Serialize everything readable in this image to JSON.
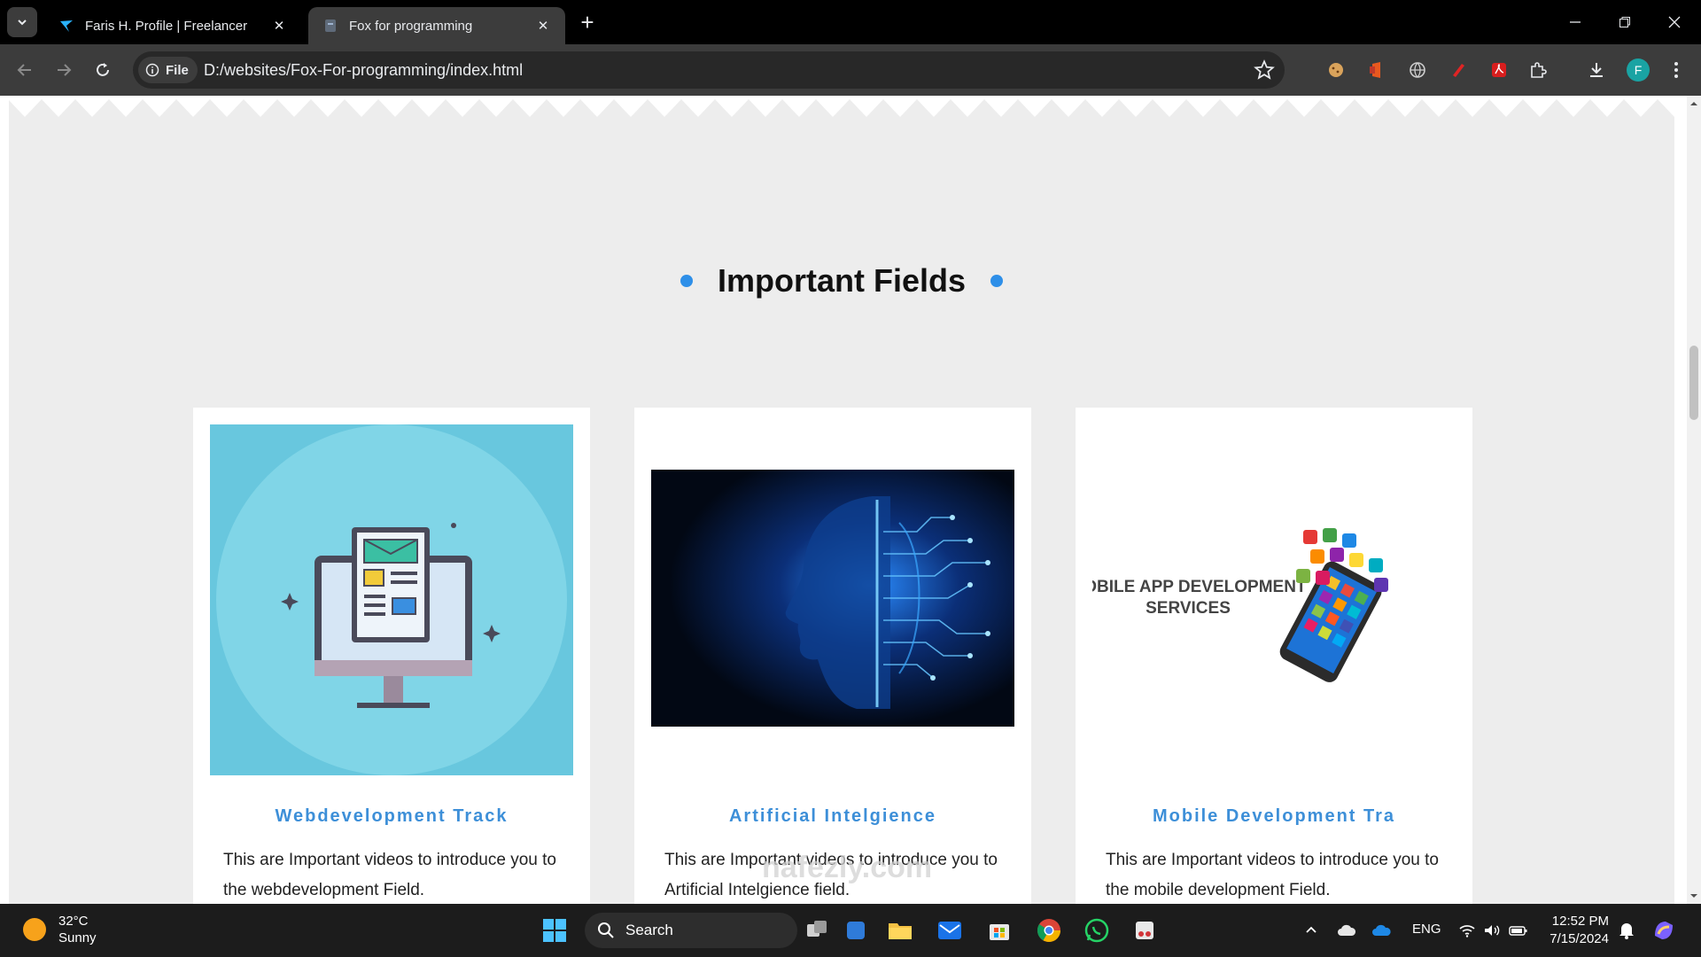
{
  "browser": {
    "tabs": [
      {
        "title": "Faris H. Profile | Freelancer",
        "active": false
      },
      {
        "title": "Fox for programming",
        "active": true
      }
    ],
    "url_chip": "File",
    "url": "D:/websites/Fox-For-programming/index.html",
    "profile_initial": "F"
  },
  "page": {
    "section_title": "Important Fields",
    "cards": [
      {
        "title": "Webdevelopment Track",
        "description": "This are Important videos to introduce you to the webdevelopment Field."
      },
      {
        "title": "Artificial Intelgience",
        "description": "This are Important videos to introduce you to Artificial Intelgience field."
      },
      {
        "title": "Mobile Development Tra",
        "description": "This are Important videos to introduce you to the mobile development Field."
      }
    ],
    "mobile_image_text": [
      "MOBILE APP DEVELOPMENT",
      "SERVICES"
    ]
  },
  "taskbar": {
    "weather_temp": "32°C",
    "weather_desc": "Sunny",
    "search_label": "Search",
    "language": "ENG",
    "time": "12:52 PM",
    "date": "7/15/2024"
  },
  "watermark": "nafezly.com",
  "colors": {
    "accent": "#2e8fe8",
    "card_title": "#3d8fd8",
    "section_bg": "#ededed"
  }
}
